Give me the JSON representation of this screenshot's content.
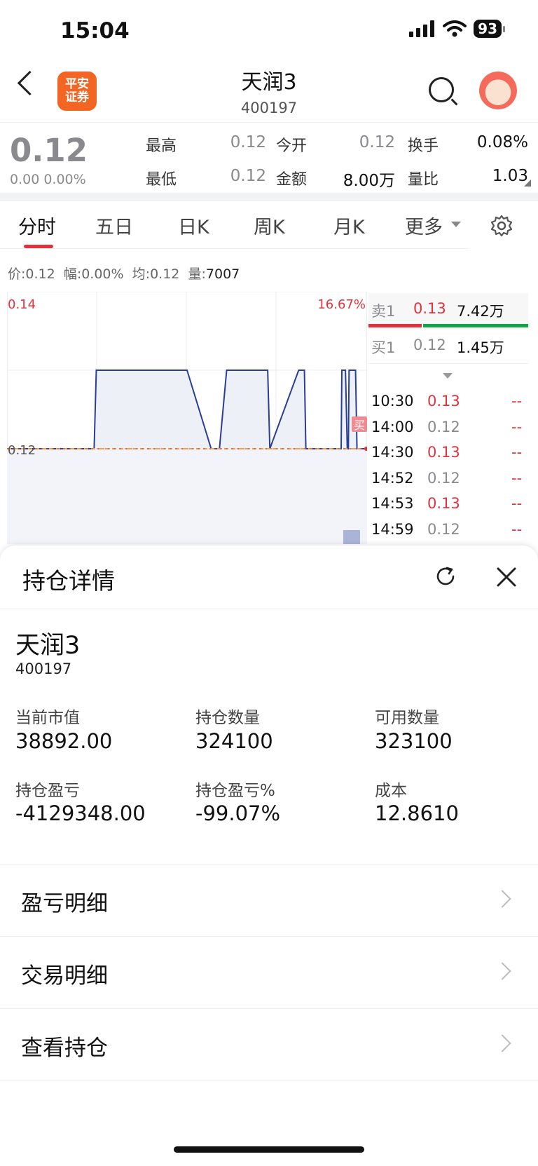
{
  "status": {
    "time": "15:04",
    "battery": "93"
  },
  "header": {
    "logo_line1": "平安",
    "logo_line2": "证券",
    "title": "天润3",
    "code": "400197"
  },
  "quote": {
    "price": "0.12",
    "change": "0.00 0.00%",
    "items": [
      {
        "label": "最高",
        "value": "0.12"
      },
      {
        "label": "今开",
        "value": "0.12"
      },
      {
        "label": "换手",
        "value": "0.08%"
      },
      {
        "label": "最低",
        "value": "0.12"
      },
      {
        "label": "金额",
        "value": "8.00万"
      },
      {
        "label": "量比",
        "value": "1.03"
      }
    ]
  },
  "tabs": [
    "分时",
    "五日",
    "日K",
    "周K",
    "月K",
    "更多"
  ],
  "info": {
    "price_label": "价:",
    "price": "0.12",
    "range_label": "幅:",
    "range": "0.00%",
    "avg_label": "均:",
    "avg": "0.12",
    "vol_label": "量:",
    "vol": "7007"
  },
  "chart": {
    "y_top": "0.14",
    "y_mid": "0.12",
    "pct_top": "16.67%",
    "buy_marker": "买"
  },
  "chart_data": {
    "type": "line",
    "title": "",
    "ylim": [
      0.1,
      0.14
    ],
    "series": [
      {
        "values": [
          0.12,
          0.12,
          0.13,
          0.13,
          0.13,
          0.12,
          0.12,
          0.13,
          0.13,
          0.12,
          0.13,
          0.13,
          0.12
        ]
      }
    ],
    "baseline": 0.12
  },
  "orderbook": {
    "sell1": {
      "label": "卖1",
      "price": "0.13",
      "vol": "7.42万"
    },
    "buy1": {
      "label": "买1",
      "price": "0.12",
      "vol": "1.45万"
    }
  },
  "ticks": [
    {
      "time": "10:30",
      "price": "0.13",
      "vol": "--",
      "up": true
    },
    {
      "time": "14:00",
      "price": "0.12",
      "vol": "--",
      "up": false
    },
    {
      "time": "14:30",
      "price": "0.13",
      "vol": "--",
      "up": true
    },
    {
      "time": "14:52",
      "price": "0.12",
      "vol": "--",
      "up": false
    },
    {
      "time": "14:53",
      "price": "0.13",
      "vol": "--",
      "up": true
    },
    {
      "time": "14:59",
      "price": "0.12",
      "vol": "--",
      "up": false
    }
  ],
  "panel": {
    "title": "持仓详情",
    "stock_name": "天润3",
    "stock_code": "400197",
    "metrics": [
      {
        "label": "当前市值",
        "value": "38892.00"
      },
      {
        "label": "持仓数量",
        "value": "324100"
      },
      {
        "label": "可用数量",
        "value": "323100"
      },
      {
        "label": "持仓盈亏",
        "value": "-4129348.00"
      },
      {
        "label": "持仓盈亏%",
        "value": "-99.07%"
      },
      {
        "label": "成本",
        "value": "12.8610"
      }
    ],
    "menu": [
      "盈亏明细",
      "交易明细",
      "查看持仓"
    ]
  },
  "colors": {
    "accent_red": "#e0323c",
    "loss_green": "#15a34a",
    "line_blue": "#2a3f94",
    "brand_orange": "#f26522"
  }
}
